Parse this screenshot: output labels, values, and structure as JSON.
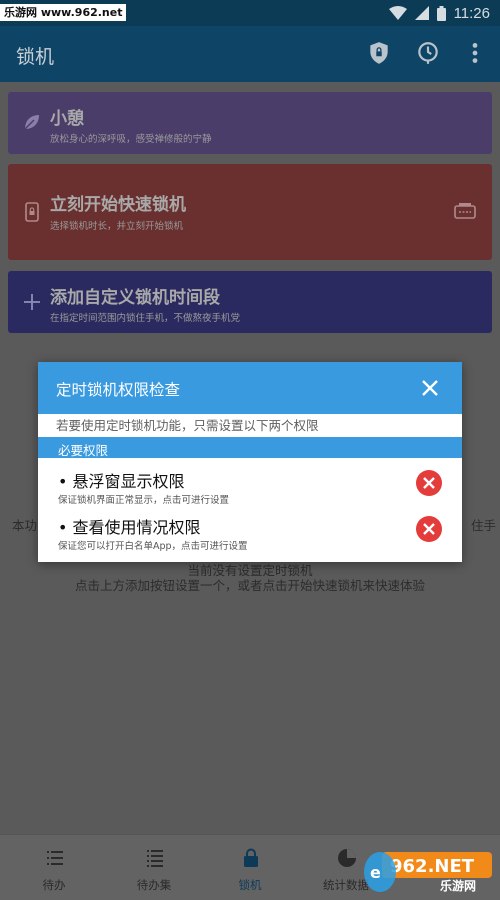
{
  "status_bar": {
    "watermark": "乐游网 www.962.net",
    "time": "11:26"
  },
  "app_bar": {
    "title": "锁机",
    "icons": [
      "shield-lock-icon",
      "clock-icon",
      "more-vert-icon"
    ]
  },
  "cards": [
    {
      "title": "小憩",
      "subtitle": "放松身心的深呼吸，感受禅修般的宁静",
      "icon": "leaf-icon",
      "color": "#4a3d6a"
    },
    {
      "title": "立刻开始快速锁机",
      "subtitle": "选择锁机时长，并立刻开始锁机",
      "icon": "phone-lock-icon",
      "right_icon": "timer-icon",
      "color": "#6a2f2f"
    },
    {
      "title": "添加自定义锁机时间段",
      "subtitle": "在指定时间范围内锁住手机，不做熬夜手机党",
      "icon": "plus-icon",
      "color": "#2a2a60"
    }
  ],
  "background_text": {
    "left_fragment": "本功",
    "right_fragment": "住手",
    "line1": "当前没有设置定时锁机",
    "line2": "点击上方添加按钮设置一个，或者点击开始快速锁机来快速体验"
  },
  "bottom_nav": [
    {
      "label": "待办",
      "icon": "list-icon"
    },
    {
      "label": "待办集",
      "icon": "list-detail-icon"
    },
    {
      "label": "锁机",
      "icon": "lock-icon",
      "active": true
    },
    {
      "label": "统计数据",
      "icon": "pie-chart-icon"
    },
    {
      "label": "",
      "icon": "more-icon"
    }
  ],
  "branding": {
    "logo_text": "962.NET",
    "site_text": "乐游网"
  },
  "dialog": {
    "title": "定时锁机权限检查",
    "description": "若要使用定时锁机功能，只需设置以下两个权限",
    "section_label": "必要权限",
    "permissions": [
      {
        "title": "• 悬浮窗显示权限",
        "subtitle": "保证锁机界面正常显示，点击可进行设置",
        "status": "not-granted"
      },
      {
        "title": "• 查看使用情况权限",
        "subtitle": "保证您可以打开白名单App，点击可进行设置",
        "status": "not-granted"
      }
    ]
  },
  "colors": {
    "dialog_accent": "#3a9ae0",
    "error": "#e43b3b",
    "app_bar": "#0e4466"
  }
}
